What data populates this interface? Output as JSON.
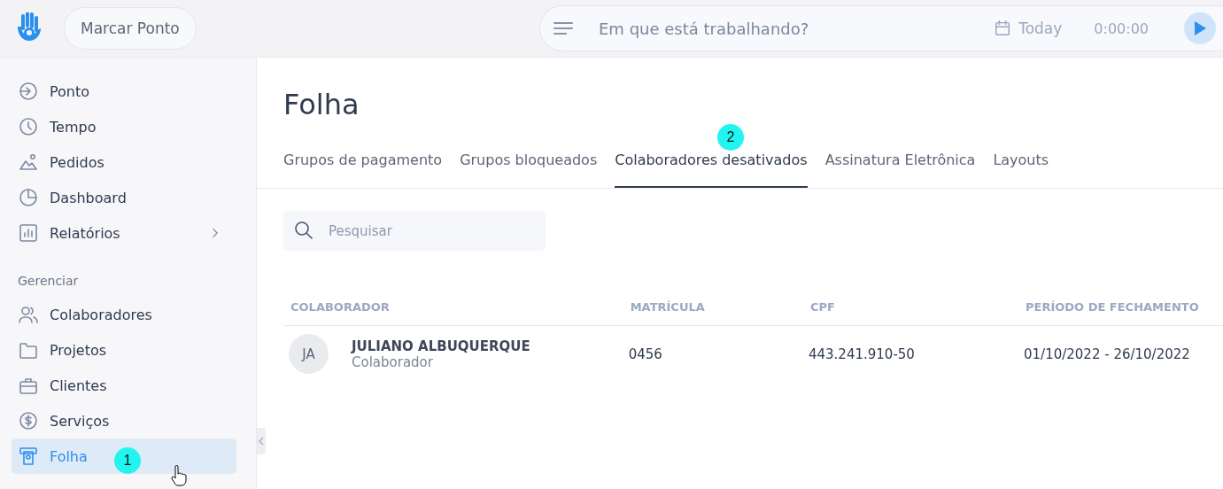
{
  "topbar": {
    "clock_in_button": "Marcar Ponto",
    "timer": {
      "placeholder": "Em que está trabalhando?",
      "date": "Today",
      "elapsed": "0:00:00"
    }
  },
  "sidebar": {
    "items": [
      {
        "label": "Ponto",
        "selected": false,
        "has_submenu": false
      },
      {
        "label": "Tempo",
        "selected": false,
        "has_submenu": false
      },
      {
        "label": "Pedidos",
        "selected": false,
        "has_submenu": false
      },
      {
        "label": "Dashboard",
        "selected": false,
        "has_submenu": false
      },
      {
        "label": "Relatórios",
        "selected": false,
        "has_submenu": true
      }
    ],
    "section_title": "Gerenciar",
    "manage_items": [
      {
        "label": "Colaboradores",
        "selected": false
      },
      {
        "label": "Projetos",
        "selected": false
      },
      {
        "label": "Clientes",
        "selected": false
      },
      {
        "label": "Serviços",
        "selected": false
      },
      {
        "label": "Folha",
        "selected": true
      }
    ]
  },
  "page": {
    "title": "Folha",
    "tabs": [
      {
        "label": "Grupos de pagamento",
        "selected": false
      },
      {
        "label": "Grupos bloqueados",
        "selected": false
      },
      {
        "label": "Colaboradores desativados",
        "selected": true
      },
      {
        "label": "Assinatura Eletrônica",
        "selected": false
      },
      {
        "label": "Layouts",
        "selected": false
      }
    ],
    "search": {
      "placeholder": "Pesquisar"
    },
    "table": {
      "columns": [
        "COLABORADOR",
        "MATRÍCULA",
        "CPF",
        "PERÍODO DE FECHAMENTO"
      ],
      "rows": [
        {
          "initials": "JA",
          "name": "JULIANO ALBUQUERQUE",
          "role": "Colaborador",
          "registration": "0456",
          "cpf": "443.241.910-50",
          "period": "01/10/2022 - 26/10/2022"
        }
      ]
    }
  },
  "annotations": [
    {
      "label": "1"
    },
    {
      "label": "2"
    }
  ]
}
